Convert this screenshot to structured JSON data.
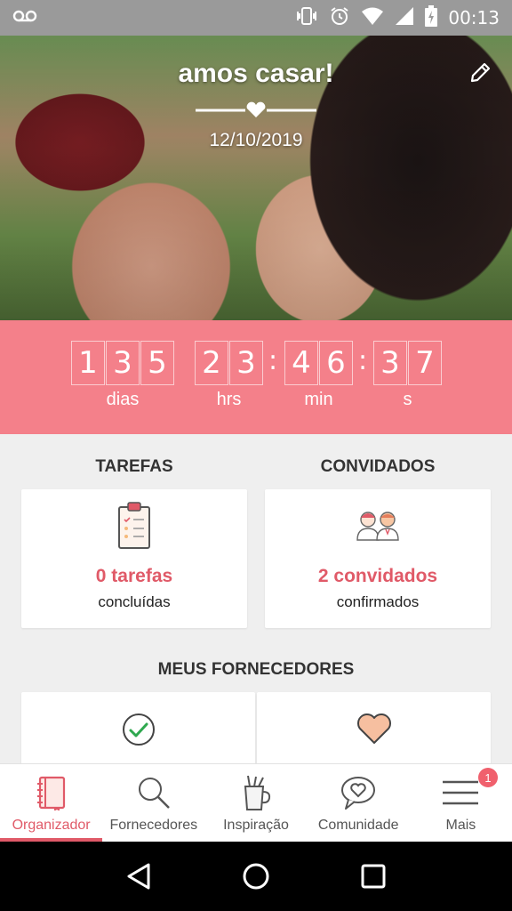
{
  "status_bar": {
    "time": "00:13",
    "icons": [
      "voicemail-icon",
      "vibrate-icon",
      "alarm-icon",
      "wifi-icon",
      "signal-icon",
      "battery-charging-icon"
    ]
  },
  "hero": {
    "title": "amos casar!",
    "date": "12/10/2019",
    "edit_icon": "pencil-icon"
  },
  "countdown": {
    "groups": [
      {
        "digits": [
          "1",
          "3",
          "5"
        ],
        "label": "dias"
      },
      {
        "digits": [
          "2",
          "3"
        ],
        "label": "hrs"
      },
      {
        "digits": [
          "4",
          "6"
        ],
        "label": "min"
      },
      {
        "digits": [
          "3",
          "7"
        ],
        "label": "s"
      }
    ],
    "separator": ":"
  },
  "tasks": {
    "section_title": "TAREFAS",
    "count": "0 tarefas",
    "subtitle": "concluídas",
    "icon": "clipboard-checklist-icon"
  },
  "guests": {
    "section_title": "CONVIDADOS",
    "count": "2 convidados",
    "subtitle": "confirmados",
    "icon": "couple-icon"
  },
  "vendors": {
    "section_title": "MEUS FORNECEDORES",
    "cards": [
      {
        "icon": "checkmark-circle-icon"
      },
      {
        "icon": "heart-icon"
      }
    ]
  },
  "bottom_nav": {
    "items": [
      {
        "label": "Organizador",
        "icon": "notebook-icon",
        "active": true
      },
      {
        "label": "Fornecedores",
        "icon": "search-icon",
        "active": false
      },
      {
        "label": "Inspiração",
        "icon": "pencil-cup-icon",
        "active": false
      },
      {
        "label": "Comunidade",
        "icon": "chat-heart-icon",
        "active": false
      },
      {
        "label": "Mais",
        "icon": "menu-icon",
        "active": false,
        "badge": "1"
      }
    ]
  },
  "system_nav": {
    "buttons": [
      "back-icon",
      "home-icon",
      "recents-icon"
    ]
  },
  "colors": {
    "accent": "#e05a68",
    "countdown_bg": "#f4808a",
    "page_bg": "#efefef"
  }
}
